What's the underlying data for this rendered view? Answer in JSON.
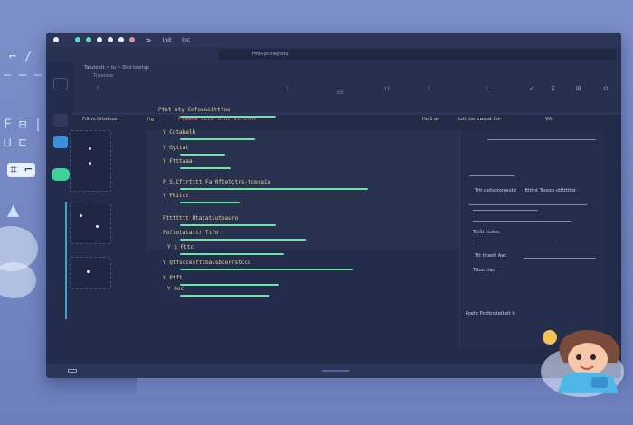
{
  "titlebar": {
    "dots": [
      "#e8eefc",
      "#5fe0b4",
      "#5fe0b4",
      "#e8eefc",
      "#e8eefc",
      "#e8eefc",
      "#f08aa0"
    ],
    "nav_label": ">",
    "tab_label": "Ind",
    "tab2_label": "Inc"
  },
  "addressbar": {
    "text": "Hnt+pdniegstiu"
  },
  "header": {
    "crumb": "Tatutoutt ~ tu ~ Oikt tcoriup",
    "crumb2": "Tlisoniaa"
  },
  "sections": {
    "left_title": "Frlt ro Hrlsdroen",
    "mid_title_a": "frg",
    "mid_title_b": "Plaaoe  CLCD Stoi stroloc",
    "right_title_a": "Ho 1 an",
    "right_title_b": "lutt tter cwoiat ton",
    "right_title_c": "Vtt"
  },
  "rows": [
    {
      "label": "Ptet sty Cofoaooittfoo",
      "bar": 0.32
    },
    {
      "label": "Y  Cotabalb",
      "bar": 0.25
    },
    {
      "label": "Y  Gyttat",
      "bar": 0.15
    },
    {
      "label": "Y Ftttaaa",
      "bar": 0.17
    },
    {
      "label": "P  S.Cftrtttt  Fa 0ftetctrs-tceraia",
      "bar": 0.63
    },
    {
      "label": "Y  Fkitct",
      "bar": 0.2
    },
    {
      "label": "Fttttttt  Utatatiutoauro",
      "bar": 0.32
    },
    {
      "label": "Foftotatattr  Ttfo",
      "bar": 0.42
    },
    {
      "label": "Y  S Fttc",
      "bar": 0.35
    },
    {
      "label": "Y  Qtfsccesfttbaisbcerrstcco",
      "bar": 0.58
    },
    {
      "label": "Y  Ptft",
      "bar": 0.33
    },
    {
      "label": "Y  Ooc",
      "bar": 0.3
    }
  ],
  "right_panel": {
    "items": [
      {
        "label": "Trtt caitoxtorosutd"
      },
      {
        "label": "Ifttttnt   Toosco otttttttat"
      },
      {
        "label": "Totftt  tcotec"
      },
      {
        "label": "Ttt tt aott  Aac"
      },
      {
        "label": "Tftoo  ttac"
      },
      {
        "label": "Poeht Pccttnstettatt  tt"
      }
    ]
  },
  "colors": {
    "accent_green": "#6fe3a8",
    "accent_blue": "#3fa2c8",
    "text_yellow": "#e8d78e",
    "title_red": "#e8747a"
  }
}
